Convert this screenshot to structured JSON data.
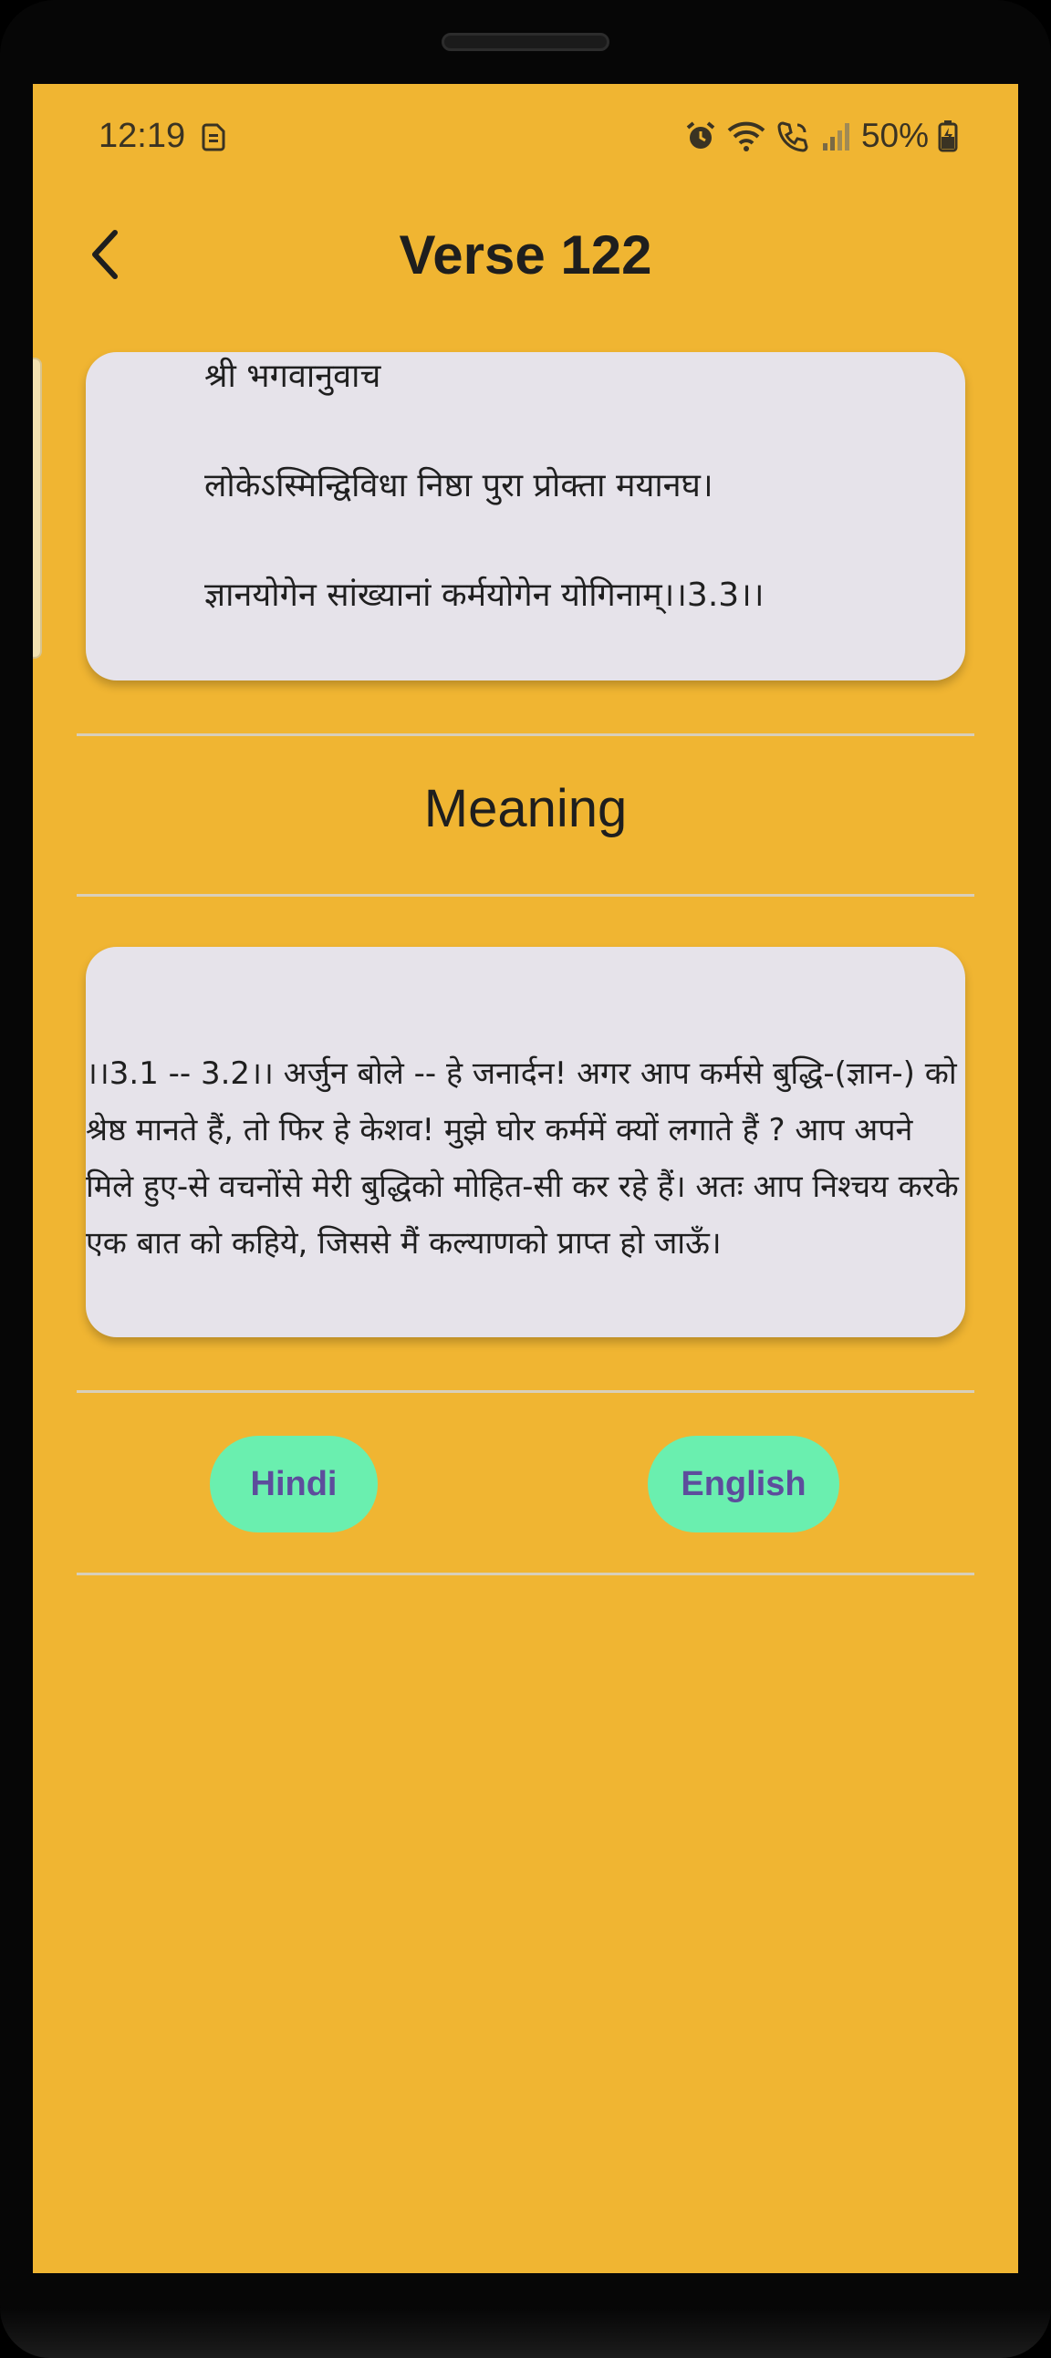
{
  "status_bar": {
    "time": "12:19",
    "battery_percent": "50%",
    "icons": [
      "sim-icon",
      "alarm-icon",
      "wifi-icon",
      "call-icon",
      "signal-icon",
      "battery-icon"
    ]
  },
  "header": {
    "title": "Verse 122",
    "back_icon": "chevron-left-icon"
  },
  "verse": {
    "lines": [
      "श्री भगवानुवाच",
      "लोकेऽस्मिन्द्विविधा निष्ठा पुरा प्रोक्ता मयानघ।",
      "ज्ञानयोगेन सांख्यानां कर्मयोगेन योगिनाम्।।3.3।।"
    ]
  },
  "meaning": {
    "heading": "Meaning",
    "text": "।।3.1 -- 3.2।। अर्जुन बोले -- हे जनार्दन! अगर आप कर्मसे बुद्धि-(ज्ञान-) को श्रेष्ठ मानते हैं, तो फिर हे केशव! मुझे घोर कर्ममें क्यों लगाते हैं ? आप अपने मिले हुए-से वचनोंसे मेरी बुद्धिको मोहित-सी कर रहे हैं। अतः आप निश्चय करके एक बात को कहिये, जिससे मैं कल्याणको प्राप्त हो जाऊँ।"
  },
  "language_buttons": {
    "hindi_label": "Hindi",
    "english_label": "English"
  },
  "colors": {
    "background": "#F0B532",
    "card": "#E6E3EA",
    "button": "#6AEFAF",
    "button_text": "#5D4D9C"
  }
}
